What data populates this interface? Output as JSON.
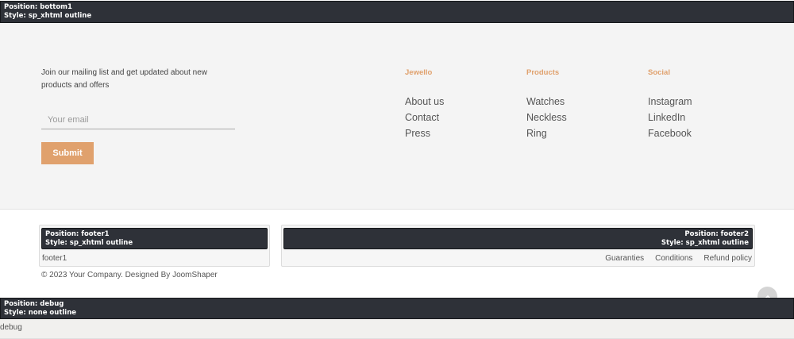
{
  "bottom_position": {
    "position": "Position: bottom1",
    "style": "Style: sp_xhtml outline"
  },
  "newsletter": {
    "text": "Join our mailing list and get updated about new products and offers",
    "email_placeholder": "Your email",
    "submit_label": "Submit"
  },
  "columns": [
    {
      "title": "Jewello",
      "links": [
        "About us",
        "Contact",
        "Press"
      ]
    },
    {
      "title": "Products",
      "links": [
        "Watches",
        "Neckless",
        "Ring"
      ]
    },
    {
      "title": "Social",
      "links": [
        "Instagram",
        "LinkedIn",
        "Facebook"
      ]
    }
  ],
  "footer1": {
    "position": "Position: footer1",
    "style": "Style: sp_xhtml outline",
    "content": "footer1"
  },
  "footer2": {
    "position": "Position: footer2",
    "style": "Style: sp_xhtml outline",
    "menu": [
      "Guaranties",
      "Conditions",
      "Refund policy"
    ]
  },
  "copyright": "© 2023 Your Company. Designed By JoomShaper",
  "debug_position": {
    "position": "Position: debug",
    "style": "Style: none outline",
    "content": "debug"
  },
  "colors": {
    "accent": "#e0a16d",
    "module_bar": "#2e3138",
    "section_bg": "#f4f4f4"
  },
  "icons": {
    "scroll_top": "chevron-up-icon"
  }
}
